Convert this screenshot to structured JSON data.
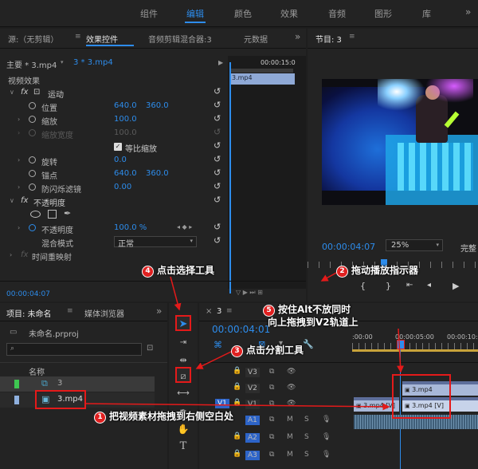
{
  "workspaces": [
    "组件",
    "编辑",
    "颜色",
    "效果",
    "音频",
    "图形",
    "库"
  ],
  "workspace_active": "编辑",
  "source_tab": "源:（无剪辑）",
  "effect_controls_tab": "效果控件",
  "audio_mixer_tab": "音频剪辑混合器:3",
  "metadata_tab": "元数据",
  "clip_path_master": "主要 * 3.mp4",
  "clip_path_seq": "3 * 3.mp4",
  "mini_timecode": "00:00:15:0",
  "mini_clip_label": "3.mp4",
  "video_effects": "视频效果",
  "motion": {
    "label": "运动",
    "position_label": "位置",
    "position_x": "640.0",
    "position_y": "360.0",
    "scale_label": "缩放",
    "scale_value": "100.0",
    "scale_width_label": "缩放宽度",
    "scale_width_value": "100.0",
    "uniform_scale_label": "等比缩放",
    "rotation_label": "旋转",
    "rotation_value": "0.0",
    "anchor_label": "锚点",
    "anchor_x": "640.0",
    "anchor_y": "360.0",
    "flicker_label": "防闪烁滤镜",
    "flicker_value": "0.00"
  },
  "opacity": {
    "label": "不透明度",
    "opacity_label": "不透明度",
    "opacity_value": "100.0 %",
    "blend_label": "混合模式",
    "blend_value": "正常"
  },
  "time_remap": "时间重映射",
  "ec_timecode": "00:00:04:07",
  "program": {
    "title": "节目: 3",
    "timecode": "00:00:04:07",
    "zoom": "25%",
    "quality": "完整"
  },
  "project": {
    "title": "项目: 未命名",
    "media_browser": "媒体浏览器",
    "file": "未命名.prproj",
    "name_col": "名称",
    "items": [
      "3",
      "3.mp4"
    ]
  },
  "timeline": {
    "seq_tab": "3",
    "timecode": "00:00:04:01",
    "ruler": [
      ":00:00",
      "00:00:05:00",
      "00:00:10:0"
    ],
    "tracks": [
      "V3",
      "V2",
      "V1",
      "A1",
      "A2",
      "A3"
    ],
    "clip_v2": "3.mp4",
    "clip_v1a": "3.mp4 [V]",
    "clip_v1b": "3.mp4 [V]"
  },
  "annotations": {
    "n1": "1",
    "t1": "把视频素材拖拽到右侧空白处",
    "n2": "2",
    "t2": "拖动播放指示器",
    "n3": "3",
    "t3": "点击分割工具",
    "n4": "4",
    "t4": "点击选择工具",
    "n5": "5",
    "t5a": "按住Alt不放同时",
    "t5b": "向上拖拽到V2轨道上"
  },
  "colors": {
    "accent": "#2d8ceb",
    "annotation_red": "#e41a1a",
    "clip_video": "#a8b8d8",
    "clip_audio": "#3f5e78"
  }
}
